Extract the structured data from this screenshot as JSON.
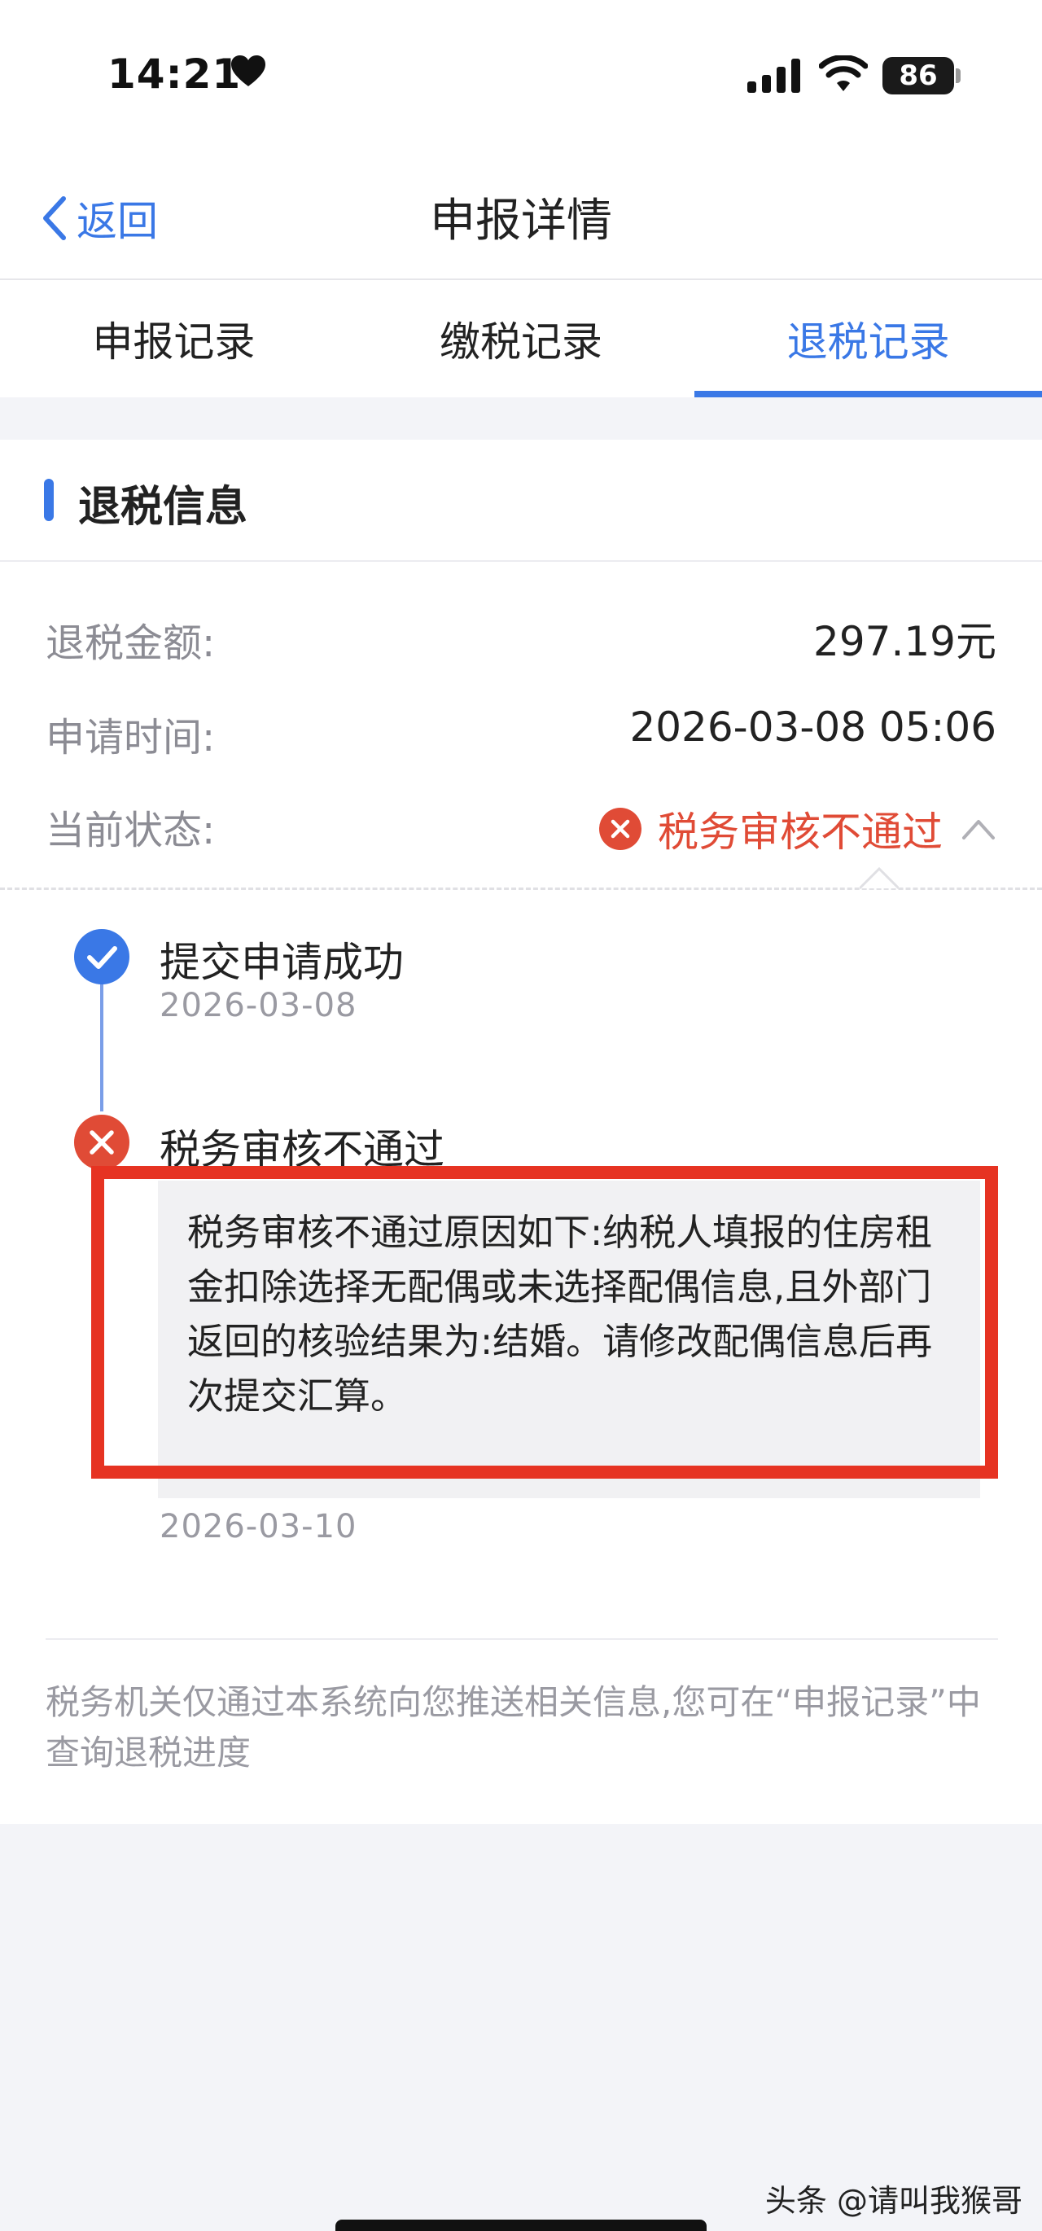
{
  "status_bar": {
    "time": "14:21",
    "battery": "86",
    "icons": [
      "heart-icon",
      "signal-icon",
      "wifi-icon",
      "battery-icon"
    ]
  },
  "nav": {
    "back_label": "返回",
    "title": "申报详情"
  },
  "tabs": [
    {
      "label": "申报记录",
      "active": false
    },
    {
      "label": "缴税记录",
      "active": false
    },
    {
      "label": "退税记录",
      "active": true
    }
  ],
  "section": {
    "title": "退税信息"
  },
  "info": {
    "amount_label": "退税金额:",
    "amount_value": "297.19元",
    "time_label": "申请时间:",
    "time_value": "2026-03-08 05:06",
    "status_label": "当前状态:",
    "status_value": "税务审核不通过"
  },
  "timeline": [
    {
      "title": "提交申请成功",
      "date": "2026-03-08",
      "state": "success"
    },
    {
      "title": "税务审核不通过",
      "reason": "税务审核不通过原因如下:纳税人填报的住房租金扣除选择无配偶或未选择配偶信息,且外部门返回的核验结果为:结婚。请修改配偶信息后再次提交汇算。",
      "date": "2026-03-10",
      "state": "failed"
    }
  ],
  "footer_note": "税务机关仅通过本系统向您推送相关信息,您可在“申报记录”中查询退税进度",
  "watermark": "头条 @请叫我猴哥",
  "colors": {
    "accent": "#3a78e6",
    "error": "#e04b36",
    "highlight_frame": "#e63322",
    "muted_text": "#9a9aa2"
  }
}
